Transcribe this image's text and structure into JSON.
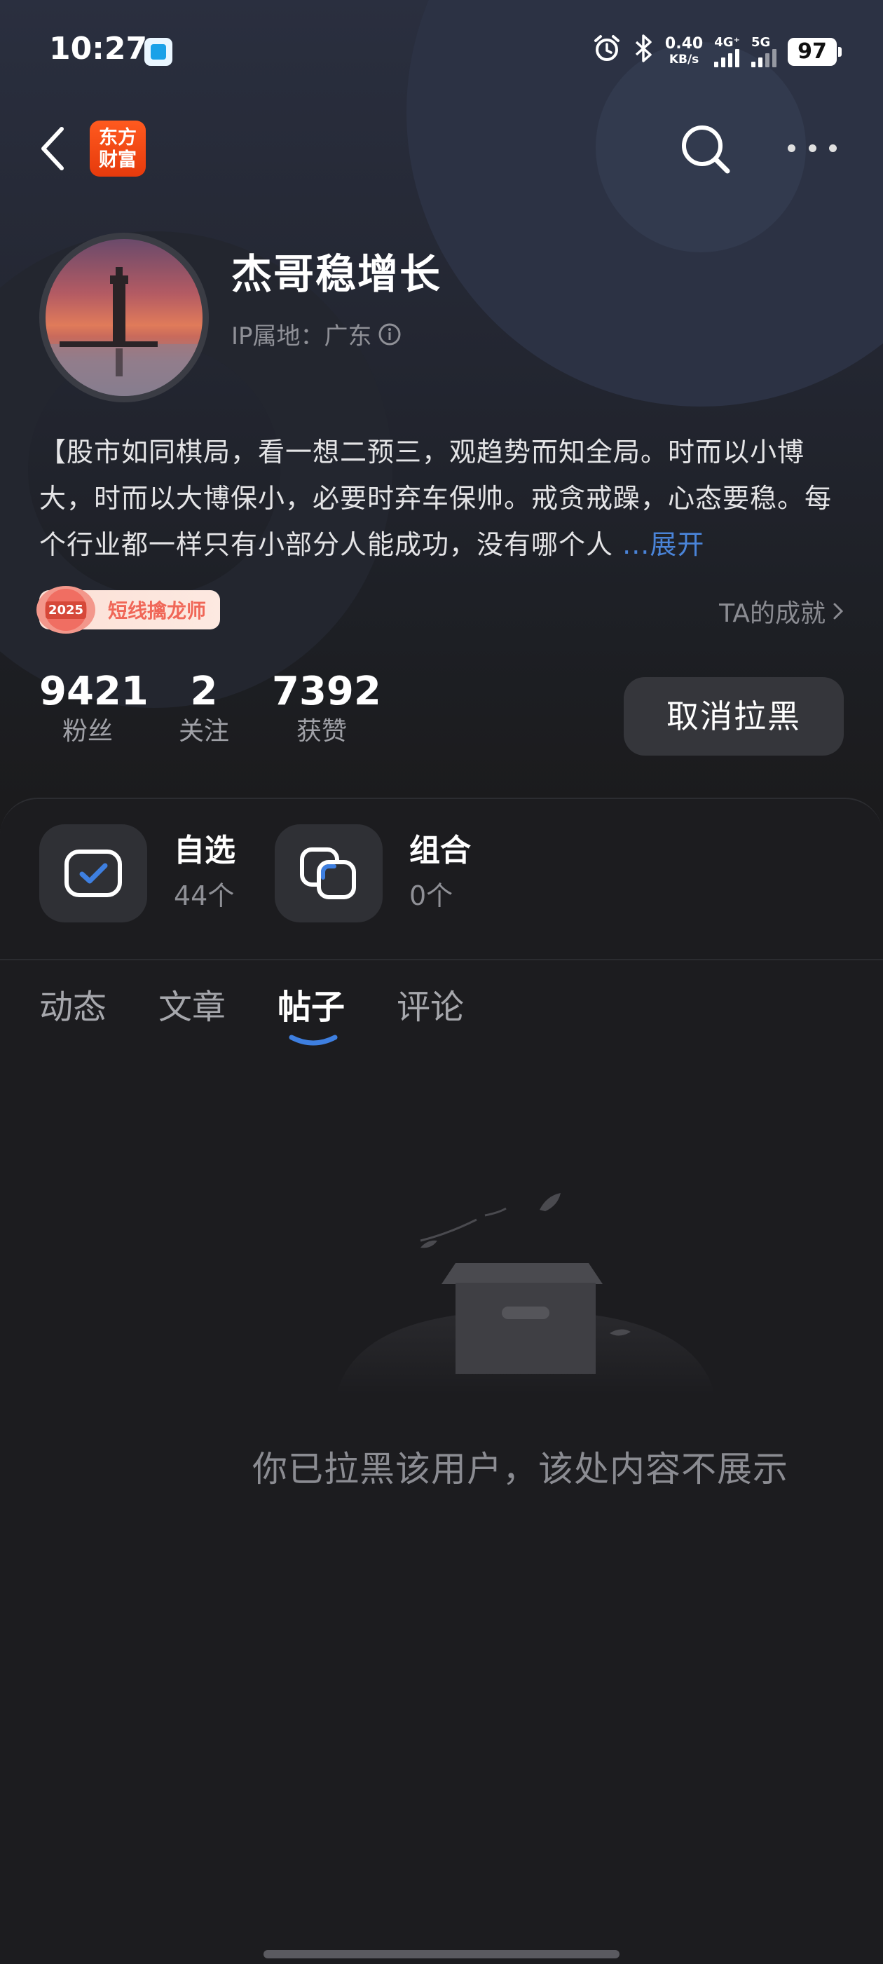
{
  "status_bar": {
    "time": "10:27",
    "net_speed_value": "0.40",
    "net_speed_unit": "KB/s",
    "sim1_label": "4G⁺",
    "sim2_label": "5G",
    "battery": "97"
  },
  "nav": {
    "logo_line1": "东方",
    "logo_line2": "财富"
  },
  "profile": {
    "username": "杰哥稳增长",
    "ip_location": "IP属地：广东",
    "bio_text": "【股市如同棋局，看一想二预三，观趋势而知全局。时而以小博大，时而以大博保小，必要时弃车保帅。戒贪戒躁，心态要稳。每个行业都一样只有小部分人能成功，没有哪个人",
    "bio_expand": "...展开",
    "badge_year": "2025",
    "badge_label": "短线擒龙师",
    "achievements_link": "TA的成就"
  },
  "stats": [
    {
      "value": "9421",
      "label": "粉丝"
    },
    {
      "value": "2",
      "label": "关注"
    },
    {
      "value": "7392",
      "label": "获赞"
    }
  ],
  "unblock_button": "取消拉黑",
  "portfolio": {
    "watchlist_title": "自选",
    "watchlist_count": "44个",
    "combo_title": "组合",
    "combo_count": "0个"
  },
  "tabs": [
    {
      "label": "动态",
      "active": false
    },
    {
      "label": "文章",
      "active": false
    },
    {
      "label": "帖子",
      "active": true
    },
    {
      "label": "评论",
      "active": false
    }
  ],
  "empty_state": {
    "message": "你已拉黑该用户，该处内容不展示"
  },
  "colors": {
    "accent_blue": "#4a84d8",
    "brand_orange": "#ff5a1f",
    "badge_red": "#f06758"
  }
}
